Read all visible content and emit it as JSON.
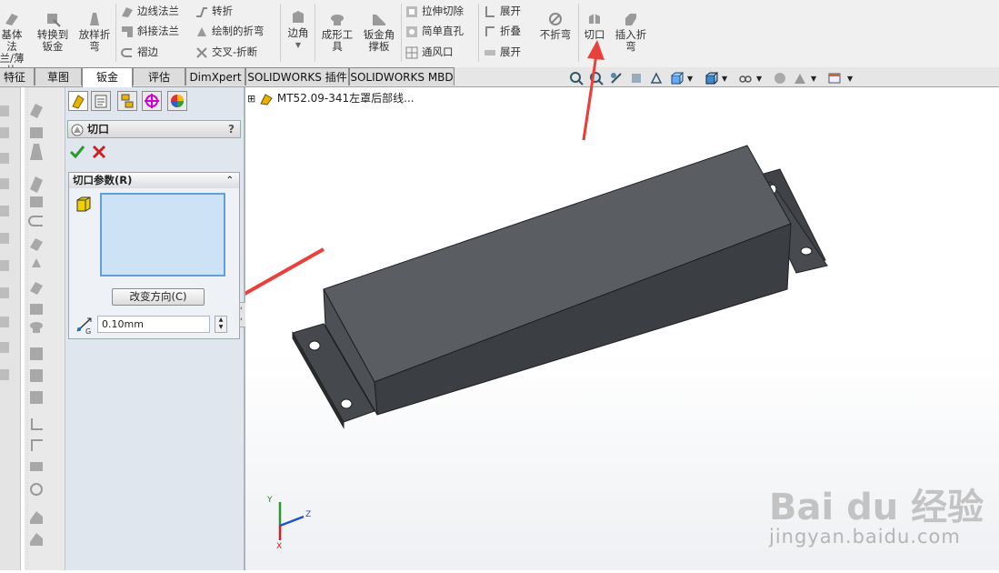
{
  "ribbon": {
    "big_buttons": [
      {
        "label1": "基体法",
        "label2": "兰/薄片"
      },
      {
        "label1": "转换到",
        "label2": "钣金"
      },
      {
        "label1": "放样折",
        "label2": "弯"
      }
    ],
    "col1": [
      "边线法兰",
      "斜接法兰",
      "褶边"
    ],
    "col2": [
      "转折",
      "绘制的折弯",
      "交叉-折断"
    ],
    "edge_angle": "边角",
    "forming_tool": {
      "label1": "成形工",
      "label2": "具"
    },
    "gusset": {
      "label1": "钣金角",
      "label2": "撑板"
    },
    "col3": [
      "拉伸切除",
      "简单直孔",
      "通风口"
    ],
    "col4": [
      "展开",
      "折叠",
      "展开"
    ],
    "no_bend": "不折弯",
    "rip": "切口",
    "insert_bends": {
      "label1": "插入折",
      "label2": "弯"
    }
  },
  "tabs": [
    "特征",
    "草图",
    "钣金",
    "评估",
    "DimXpert",
    "SOLIDWORKS 插件",
    "SOLIDWORKS MBD"
  ],
  "active_tab": "钣金",
  "property_manager": {
    "title": "切口",
    "help": "?",
    "group_title": "切口参数(R)",
    "flip_button": "改变方向(C)",
    "gap_value": "0.10mm"
  },
  "tree": {
    "expander": "⊞",
    "part_name": "MT52.09-341左罩后部线..."
  },
  "triad": {
    "x": "X",
    "y": "Y",
    "z": "Z"
  },
  "watermark": {
    "logo": "Bai du 经验",
    "url": "jingyan.baidu.com"
  },
  "colors": {
    "arrow": "#e8413c",
    "body": "#4c4f54",
    "accent": "#5fa0d8"
  }
}
